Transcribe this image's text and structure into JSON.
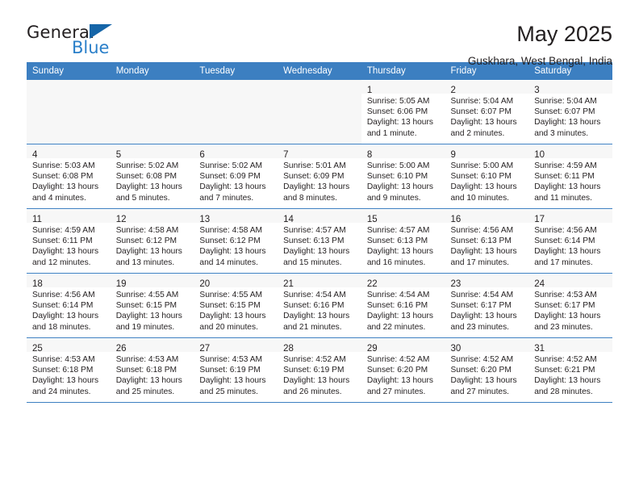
{
  "brand": {
    "name_dark": "General",
    "name_light": "Blue",
    "flag_icon": "triangle-flag-icon"
  },
  "header": {
    "title": "May 2025",
    "location": "Guskhara, West Bengal, India"
  },
  "colors": {
    "header_blue": "#3c7fc1",
    "brand_blue": "#2a7fc9",
    "cell_alt": "#f0f0f0",
    "text": "#231f20"
  },
  "calendar": {
    "weekday_headers": [
      "Sunday",
      "Monday",
      "Tuesday",
      "Wednesday",
      "Thursday",
      "Friday",
      "Saturday"
    ],
    "weeks": [
      [
        {
          "day": "",
          "lines": []
        },
        {
          "day": "",
          "lines": []
        },
        {
          "day": "",
          "lines": []
        },
        {
          "day": "",
          "lines": []
        },
        {
          "day": "1",
          "lines": [
            "Sunrise: 5:05 AM",
            "Sunset: 6:06 PM",
            "Daylight: 13 hours",
            "and 1 minute."
          ]
        },
        {
          "day": "2",
          "lines": [
            "Sunrise: 5:04 AM",
            "Sunset: 6:07 PM",
            "Daylight: 13 hours",
            "and 2 minutes."
          ]
        },
        {
          "day": "3",
          "lines": [
            "Sunrise: 5:04 AM",
            "Sunset: 6:07 PM",
            "Daylight: 13 hours",
            "and 3 minutes."
          ]
        }
      ],
      [
        {
          "day": "4",
          "lines": [
            "Sunrise: 5:03 AM",
            "Sunset: 6:08 PM",
            "Daylight: 13 hours",
            "and 4 minutes."
          ]
        },
        {
          "day": "5",
          "lines": [
            "Sunrise: 5:02 AM",
            "Sunset: 6:08 PM",
            "Daylight: 13 hours",
            "and 5 minutes."
          ]
        },
        {
          "day": "6",
          "lines": [
            "Sunrise: 5:02 AM",
            "Sunset: 6:09 PM",
            "Daylight: 13 hours",
            "and 7 minutes."
          ]
        },
        {
          "day": "7",
          "lines": [
            "Sunrise: 5:01 AM",
            "Sunset: 6:09 PM",
            "Daylight: 13 hours",
            "and 8 minutes."
          ]
        },
        {
          "day": "8",
          "lines": [
            "Sunrise: 5:00 AM",
            "Sunset: 6:10 PM",
            "Daylight: 13 hours",
            "and 9 minutes."
          ]
        },
        {
          "day": "9",
          "lines": [
            "Sunrise: 5:00 AM",
            "Sunset: 6:10 PM",
            "Daylight: 13 hours",
            "and 10 minutes."
          ]
        },
        {
          "day": "10",
          "lines": [
            "Sunrise: 4:59 AM",
            "Sunset: 6:11 PM",
            "Daylight: 13 hours",
            "and 11 minutes."
          ]
        }
      ],
      [
        {
          "day": "11",
          "lines": [
            "Sunrise: 4:59 AM",
            "Sunset: 6:11 PM",
            "Daylight: 13 hours",
            "and 12 minutes."
          ]
        },
        {
          "day": "12",
          "lines": [
            "Sunrise: 4:58 AM",
            "Sunset: 6:12 PM",
            "Daylight: 13 hours",
            "and 13 minutes."
          ]
        },
        {
          "day": "13",
          "lines": [
            "Sunrise: 4:58 AM",
            "Sunset: 6:12 PM",
            "Daylight: 13 hours",
            "and 14 minutes."
          ]
        },
        {
          "day": "14",
          "lines": [
            "Sunrise: 4:57 AM",
            "Sunset: 6:13 PM",
            "Daylight: 13 hours",
            "and 15 minutes."
          ]
        },
        {
          "day": "15",
          "lines": [
            "Sunrise: 4:57 AM",
            "Sunset: 6:13 PM",
            "Daylight: 13 hours",
            "and 16 minutes."
          ]
        },
        {
          "day": "16",
          "lines": [
            "Sunrise: 4:56 AM",
            "Sunset: 6:13 PM",
            "Daylight: 13 hours",
            "and 17 minutes."
          ]
        },
        {
          "day": "17",
          "lines": [
            "Sunrise: 4:56 AM",
            "Sunset: 6:14 PM",
            "Daylight: 13 hours",
            "and 17 minutes."
          ]
        }
      ],
      [
        {
          "day": "18",
          "lines": [
            "Sunrise: 4:56 AM",
            "Sunset: 6:14 PM",
            "Daylight: 13 hours",
            "and 18 minutes."
          ]
        },
        {
          "day": "19",
          "lines": [
            "Sunrise: 4:55 AM",
            "Sunset: 6:15 PM",
            "Daylight: 13 hours",
            "and 19 minutes."
          ]
        },
        {
          "day": "20",
          "lines": [
            "Sunrise: 4:55 AM",
            "Sunset: 6:15 PM",
            "Daylight: 13 hours",
            "and 20 minutes."
          ]
        },
        {
          "day": "21",
          "lines": [
            "Sunrise: 4:54 AM",
            "Sunset: 6:16 PM",
            "Daylight: 13 hours",
            "and 21 minutes."
          ]
        },
        {
          "day": "22",
          "lines": [
            "Sunrise: 4:54 AM",
            "Sunset: 6:16 PM",
            "Daylight: 13 hours",
            "and 22 minutes."
          ]
        },
        {
          "day": "23",
          "lines": [
            "Sunrise: 4:54 AM",
            "Sunset: 6:17 PM",
            "Daylight: 13 hours",
            "and 23 minutes."
          ]
        },
        {
          "day": "24",
          "lines": [
            "Sunrise: 4:53 AM",
            "Sunset: 6:17 PM",
            "Daylight: 13 hours",
            "and 23 minutes."
          ]
        }
      ],
      [
        {
          "day": "25",
          "lines": [
            "Sunrise: 4:53 AM",
            "Sunset: 6:18 PM",
            "Daylight: 13 hours",
            "and 24 minutes."
          ]
        },
        {
          "day": "26",
          "lines": [
            "Sunrise: 4:53 AM",
            "Sunset: 6:18 PM",
            "Daylight: 13 hours",
            "and 25 minutes."
          ]
        },
        {
          "day": "27",
          "lines": [
            "Sunrise: 4:53 AM",
            "Sunset: 6:19 PM",
            "Daylight: 13 hours",
            "and 25 minutes."
          ]
        },
        {
          "day": "28",
          "lines": [
            "Sunrise: 4:52 AM",
            "Sunset: 6:19 PM",
            "Daylight: 13 hours",
            "and 26 minutes."
          ]
        },
        {
          "day": "29",
          "lines": [
            "Sunrise: 4:52 AM",
            "Sunset: 6:20 PM",
            "Daylight: 13 hours",
            "and 27 minutes."
          ]
        },
        {
          "day": "30",
          "lines": [
            "Sunrise: 4:52 AM",
            "Sunset: 6:20 PM",
            "Daylight: 13 hours",
            "and 27 minutes."
          ]
        },
        {
          "day": "31",
          "lines": [
            "Sunrise: 4:52 AM",
            "Sunset: 6:21 PM",
            "Daylight: 13 hours",
            "and 28 minutes."
          ]
        }
      ]
    ]
  }
}
